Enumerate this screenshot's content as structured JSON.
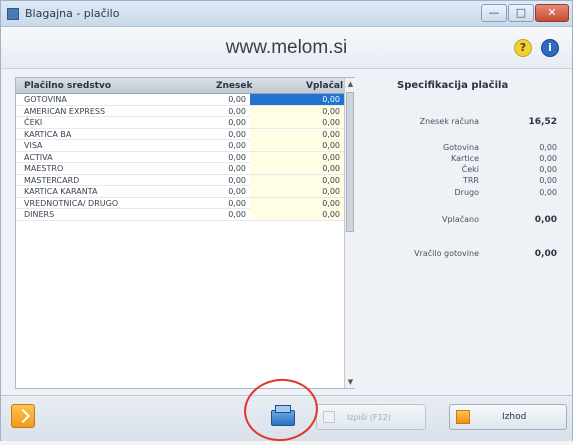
{
  "window": {
    "title": "Blagajna - plačilo",
    "min_label": "—",
    "max_label": "□",
    "close_label": "✕"
  },
  "header": {
    "site": "www.melom.si",
    "help_label": "?",
    "info_label": "i"
  },
  "table": {
    "columns": {
      "name": "Plačilno sredstvo",
      "znesek": "Znesek",
      "vplacal": "Vplačal"
    },
    "rows": [
      {
        "name": "GOTOVINA",
        "znesek": "0,00",
        "vplacal": "0,00"
      },
      {
        "name": "AMERICAN EXPRESS",
        "znesek": "0,00",
        "vplacal": "0,00"
      },
      {
        "name": "ČEKI",
        "znesek": "0,00",
        "vplacal": "0,00"
      },
      {
        "name": "KARTICA BA",
        "znesek": "0,00",
        "vplacal": "0,00"
      },
      {
        "name": "VISA",
        "znesek": "0,00",
        "vplacal": "0,00"
      },
      {
        "name": "ACTIVA",
        "znesek": "0,00",
        "vplacal": "0,00"
      },
      {
        "name": "MAESTRO",
        "znesek": "0,00",
        "vplacal": "0,00"
      },
      {
        "name": "MASTERCARD",
        "znesek": "0,00",
        "vplacal": "0,00"
      },
      {
        "name": "KARTICA KARANTA",
        "znesek": "0,00",
        "vplacal": "0,00"
      },
      {
        "name": "VREDNOTNICA/ DRUGO",
        "znesek": "0,00",
        "vplacal": "0,00"
      },
      {
        "name": "DINERS",
        "znesek": "0,00",
        "vplacal": "0,00"
      }
    ],
    "scroll_up": "▲",
    "scroll_down": "▼"
  },
  "spec": {
    "title": "Specifikacija plačila",
    "znesek_racuna_label": "Znesek računa",
    "znesek_racuna": "16,52",
    "gotovina_label": "Gotovina",
    "gotovina": "0,00",
    "kartice_label": "Kartice",
    "kartice": "0,00",
    "ceki_label": "Čeki",
    "ceki": "0,00",
    "trr_label": "TRR",
    "trr": "0,00",
    "drugo_label": "Drugo",
    "drugo": "0,00",
    "vplacano_label": "Vplačano",
    "vplacano": "0,00",
    "vracilo_label": "Vračilo gotovine",
    "vracilo": "0,00"
  },
  "footer": {
    "print_label": "Izpiši (F12)",
    "exit_label": "Izhod"
  }
}
